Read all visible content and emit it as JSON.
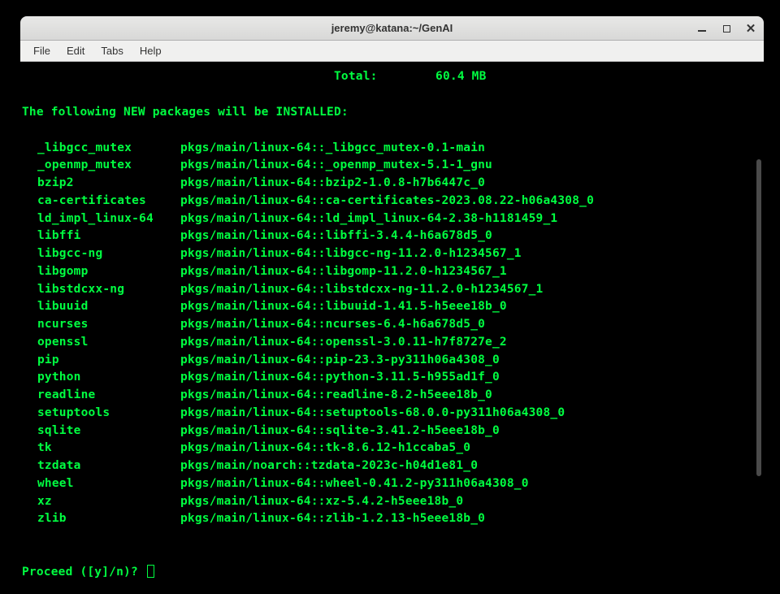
{
  "titlebar": {
    "title": "jeremy@katana:~/GenAI"
  },
  "menubar": {
    "items": [
      "File",
      "Edit",
      "Tabs",
      "Help"
    ]
  },
  "terminal": {
    "total_label": "Total:",
    "total_value": "60.4 MB",
    "header": "The following NEW packages will be INSTALLED:",
    "packages": [
      {
        "name": "_libgcc_mutex",
        "spec": "pkgs/main/linux-64::_libgcc_mutex-0.1-main"
      },
      {
        "name": "_openmp_mutex",
        "spec": "pkgs/main/linux-64::_openmp_mutex-5.1-1_gnu"
      },
      {
        "name": "bzip2",
        "spec": "pkgs/main/linux-64::bzip2-1.0.8-h7b6447c_0"
      },
      {
        "name": "ca-certificates",
        "spec": "pkgs/main/linux-64::ca-certificates-2023.08.22-h06a4308_0"
      },
      {
        "name": "ld_impl_linux-64",
        "spec": "pkgs/main/linux-64::ld_impl_linux-64-2.38-h1181459_1"
      },
      {
        "name": "libffi",
        "spec": "pkgs/main/linux-64::libffi-3.4.4-h6a678d5_0"
      },
      {
        "name": "libgcc-ng",
        "spec": "pkgs/main/linux-64::libgcc-ng-11.2.0-h1234567_1"
      },
      {
        "name": "libgomp",
        "spec": "pkgs/main/linux-64::libgomp-11.2.0-h1234567_1"
      },
      {
        "name": "libstdcxx-ng",
        "spec": "pkgs/main/linux-64::libstdcxx-ng-11.2.0-h1234567_1"
      },
      {
        "name": "libuuid",
        "spec": "pkgs/main/linux-64::libuuid-1.41.5-h5eee18b_0"
      },
      {
        "name": "ncurses",
        "spec": "pkgs/main/linux-64::ncurses-6.4-h6a678d5_0"
      },
      {
        "name": "openssl",
        "spec": "pkgs/main/linux-64::openssl-3.0.11-h7f8727e_2"
      },
      {
        "name": "pip",
        "spec": "pkgs/main/linux-64::pip-23.3-py311h06a4308_0"
      },
      {
        "name": "python",
        "spec": "pkgs/main/linux-64::python-3.11.5-h955ad1f_0"
      },
      {
        "name": "readline",
        "spec": "pkgs/main/linux-64::readline-8.2-h5eee18b_0"
      },
      {
        "name": "setuptools",
        "spec": "pkgs/main/linux-64::setuptools-68.0.0-py311h06a4308_0"
      },
      {
        "name": "sqlite",
        "spec": "pkgs/main/linux-64::sqlite-3.41.2-h5eee18b_0"
      },
      {
        "name": "tk",
        "spec": "pkgs/main/linux-64::tk-8.6.12-h1ccaba5_0"
      },
      {
        "name": "tzdata",
        "spec": "pkgs/main/noarch::tzdata-2023c-h04d1e81_0"
      },
      {
        "name": "wheel",
        "spec": "pkgs/main/linux-64::wheel-0.41.2-py311h06a4308_0"
      },
      {
        "name": "xz",
        "spec": "pkgs/main/linux-64::xz-5.4.2-h5eee18b_0"
      },
      {
        "name": "zlib",
        "spec": "pkgs/main/linux-64::zlib-1.2.13-h5eee18b_0"
      }
    ],
    "prompt": "Proceed ([y]/n)? "
  }
}
